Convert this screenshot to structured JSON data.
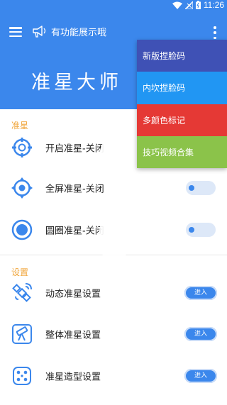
{
  "status_bar": {
    "time": "11:26",
    "icons": [
      "wifi-icon",
      "signal-icon",
      "battery-icon"
    ]
  },
  "header": {
    "menu_icon": "hamburger-icon",
    "notice_icon": "megaphone-icon",
    "notice_text": "有功能展示哦",
    "title": "准星大师",
    "more_icon": "more-vertical-icon"
  },
  "sections": {
    "crosshair_label": "准星",
    "settings_label": "设置"
  },
  "crosshair_rows": [
    {
      "label": "开启准星-关闭",
      "icon": "target-icon"
    },
    {
      "label": "全屏准星-关闭",
      "icon": "fullscreen-target-icon",
      "toggle": "off"
    },
    {
      "label": "圆圈准星-关闭",
      "icon": "circle-target-icon",
      "toggle": "off"
    }
  ],
  "settings_rows": [
    {
      "label": "动态准星设置",
      "icon": "satellite-icon",
      "button": "进入"
    },
    {
      "label": "整体准星设置",
      "icon": "telescope-icon",
      "button": "进入"
    },
    {
      "label": "准星造型设置",
      "icon": "dice-icon",
      "button": "进入"
    }
  ],
  "dropdown": {
    "items": [
      {
        "label": "新版捏脸码",
        "color": "#3f51b5"
      },
      {
        "label": "内坎捏脸码",
        "color": "#2196f3"
      },
      {
        "label": "多颜色标记",
        "color": "#e53935"
      },
      {
        "label": "技巧视频合集",
        "color": "#8bc34a"
      }
    ]
  },
  "colors": {
    "primary": "#3b87ec",
    "section_label": "#f0a63c"
  }
}
